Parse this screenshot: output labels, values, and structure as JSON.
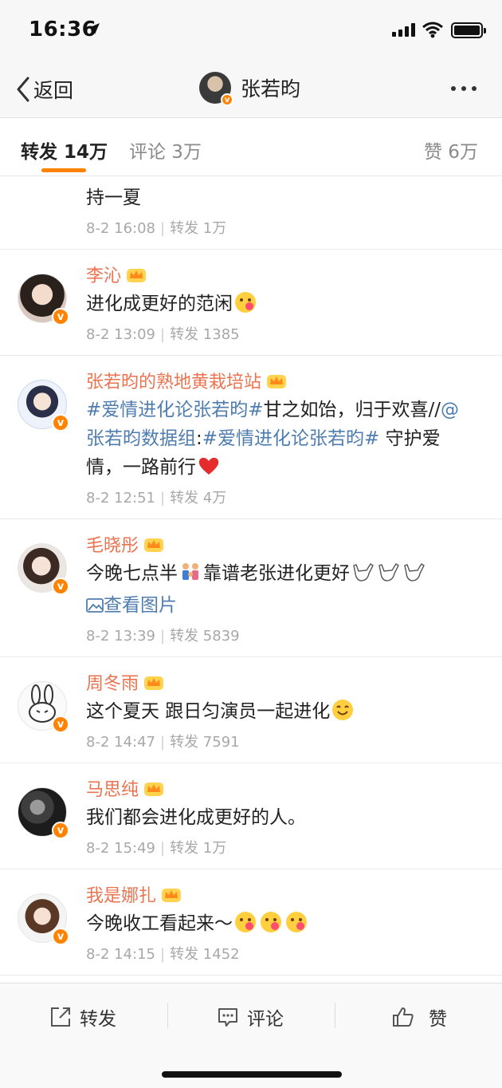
{
  "status_bar": {
    "time": "16:36"
  },
  "nav": {
    "back_label": "返回",
    "title": "张若昀"
  },
  "tabs": [
    {
      "label": "转发 14万",
      "active": true
    },
    {
      "label": "评论 3万",
      "active": false
    },
    {
      "label": "赞 6万",
      "active": false
    }
  ],
  "feed": [
    {
      "name": "",
      "text": "持一夏",
      "time": "8-2 16:08",
      "repost": "转发 1万"
    },
    {
      "name": "李沁",
      "text": "进化成更好的范闲",
      "time": "8-2 13:09",
      "repost": "转发 1385"
    },
    {
      "name": "张若昀的熟地黄栽培站",
      "text_parts": [
        "#爱情进化论张若昀#",
        "甘之如饴，归于欢喜//",
        "@张若昀数据组",
        ":",
        "#爱情进化论张若昀#",
        " 守护爱情，一路前行"
      ],
      "time": "8-2 12:51",
      "repost": "转发 4万"
    },
    {
      "name": "毛晓彤",
      "text": "今晚七点半",
      "text2": "靠谱老张进化更好",
      "link": "查看图片",
      "time": "8-2 13:39",
      "repost": "转发 5839"
    },
    {
      "name": "周冬雨",
      "text": "这个夏天 跟日匀演员一起进化",
      "time": "8-2 14:47",
      "repost": "转发 7591"
    },
    {
      "name": "马思纯",
      "text": "我们都会进化成更好的人。",
      "time": "8-2 15:49",
      "repost": "转发 1万"
    },
    {
      "name": "我是娜扎",
      "text": "今晚收工看起来～",
      "time": "8-2 14:15",
      "repost": "转发 1452"
    }
  ],
  "toolbar": {
    "repost": "转发",
    "comment": "评论",
    "like": "赞"
  },
  "colors": {
    "accent": "#ff8200",
    "name": "#eb7350",
    "topic": "#507daf",
    "meta": "#a8a8a8"
  }
}
